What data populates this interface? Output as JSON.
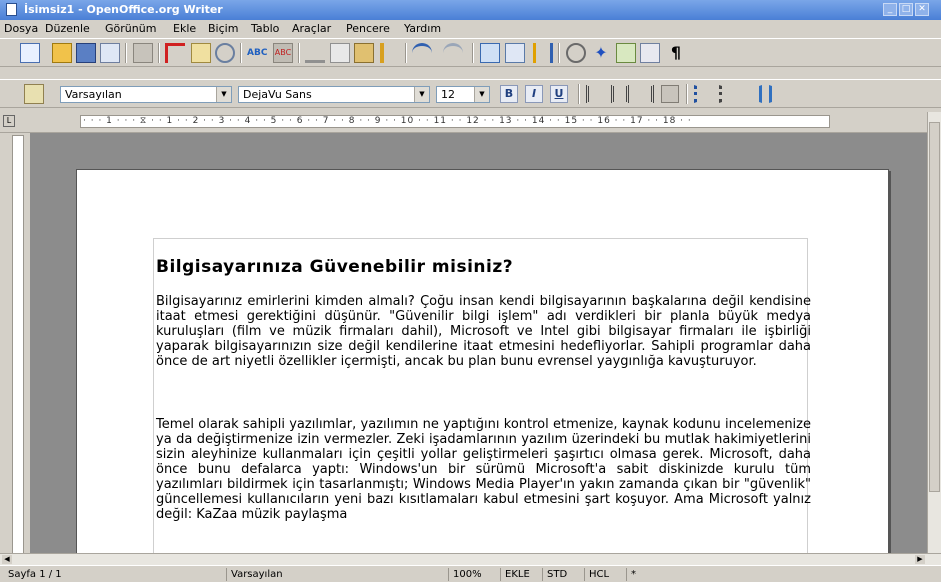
{
  "window": {
    "title": "İsimsiz1 - OpenOffice.org Writer",
    "minimize": "_",
    "maximize": "□",
    "close": "✕"
  },
  "menu": [
    "Dosya",
    "Düzenle",
    "Görünüm",
    "Ekle",
    "Biçim",
    "Tablo",
    "Araçlar",
    "Pencere",
    "Yardım"
  ],
  "formatting": {
    "style": "Varsayılan",
    "font": "DejaVu Sans",
    "size": "12",
    "bold": "B",
    "italic": "I",
    "underline": "U"
  },
  "ruler": {
    "corner": "L",
    "marks": "· · · 1 · · · ⧖ · · 1 · · 2 · · 3 · · 4 · · 5 · · 6 · · 7 · · 8 · · 9 · · 10 · · 11 · · 12 · · 13 · · 14 · · 15 · · 16 · · 17 · · 18 · ·"
  },
  "document": {
    "title": "Bilgisayarınıza Güvenebilir misiniz?",
    "paragraph1": "Bilgisayarınız emirlerini kimden almalı? Çoğu insan kendi bilgisayarının başkalarına değil kendisine itaat etmesi gerektiğini düşünür. \"Güvenilir bilgi işlem\" adı verdikleri bir planla büyük medya kuruluşları (film ve müzik firmaları dahil), Microsoft ve Intel gibi bilgisayar firmaları ile işbirliği yaparak bilgisayarınızın size değil kendilerine itaat etmesini hedefliyorlar. Sahipli programlar daha önce de art niyetli özellikler içermişti, ancak bu plan bunu evrensel yaygınlığa kavuşturuyor.",
    "paragraph2": "Temel olarak sahipli yazılımlar, yazılımın ne yaptığını kontrol etmenize, kaynak kodunu incelemenize ya da değiştirmenize izin vermezler. Zeki işadamlarının yazılım üzerindeki bu mutlak hakimiyetlerini sizin aleyhinize kullanmaları için çeşitli yollar geliştirmeleri şaşırtıcı olmasa gerek. Microsoft, daha önce bunu defalarca yaptı: Windows'un bir sürümü Microsoft'a sabit diskinizde kurulu tüm yazılımları bildirmek için tasarlanmıştı; Windows Media Player'ın yakın zamanda çıkan bir \"güvenlik\" güncellemesi kullanıcıların yeni bazı kısıtlamaları kabul etmesini şart koşuyor. Ama Microsoft yalnız değil: KaZaa müzik paylaşma"
  },
  "status": {
    "page": "Sayfa 1 / 1",
    "style": "Varsayılan",
    "zoom": "100%",
    "insert": "EKLE",
    "selection": "STD",
    "hyperlink": "HCL",
    "modified": "*"
  },
  "colors": {
    "titlebar": "#4a7fd6",
    "workspace": "#8c8c8c",
    "page": "#ffffff"
  }
}
